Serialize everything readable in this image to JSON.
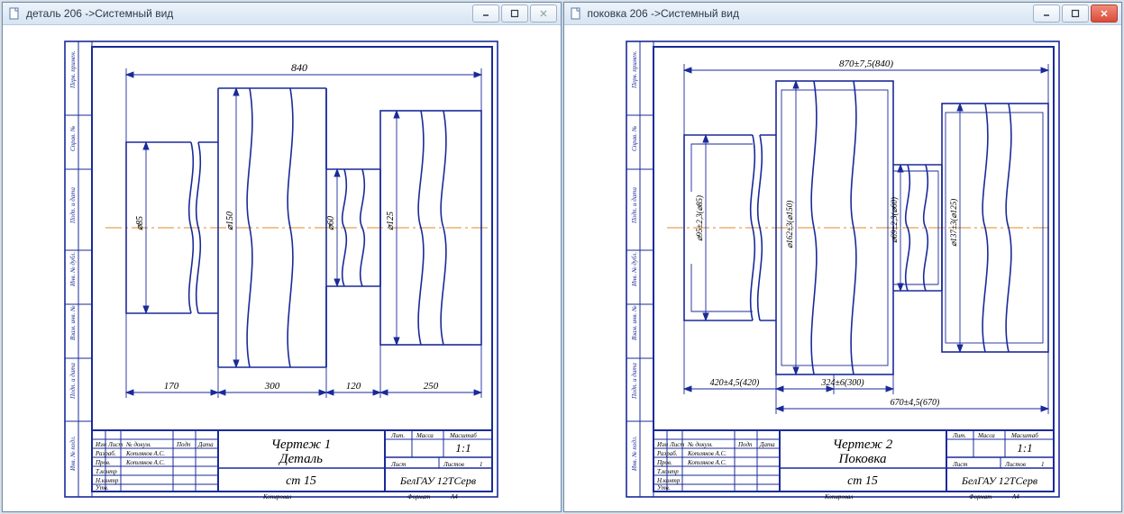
{
  "windows": [
    {
      "id": "left",
      "title": "деталь 206 ->Системный вид",
      "close_enabled": false,
      "drawing": {
        "title_line1": "Чертеж 1",
        "title_line2": "Деталь",
        "material": "ст 15",
        "org": "БелГАУ 12ТСерв",
        "scale": "1:1",
        "tb_labels": {
          "c1": "Изм",
          "c2": "Лист",
          "c3": "№ докум.",
          "c4": "Подп",
          "c5": "Дата",
          "r1": "Разраб.",
          "r2": "Пров.",
          "r3": "Т.контр",
          "r4": "Н.контр",
          "r5": "Утв.",
          "name1": "Котляков А.С.",
          "name2": "Котляков А.С.",
          "lit": "Лит.",
          "massa": "Масса",
          "mas": "Масштаб",
          "list": "Лист",
          "listov": "Листов",
          "one": "1",
          "kopiroval": "Копировал",
          "format": "Формат",
          "a4": "A4"
        },
        "side_labels": [
          "Перв. примен.",
          "Справ. №",
          "Подп. и дата",
          "Инв. № дубл.",
          "Взам. инв. №",
          "Подп. и дата",
          "Инв. № подл."
        ],
        "dims": {
          "top": "840",
          "bottoms": [
            "170",
            "300",
            "120",
            "250"
          ],
          "diams": [
            "⌀85",
            "⌀150",
            "⌀60",
            "⌀125"
          ]
        }
      }
    },
    {
      "id": "right",
      "title": "поковка 206 ->Системный вид",
      "close_enabled": true,
      "drawing": {
        "title_line1": "Чертеж 2",
        "title_line2": "Поковка",
        "material": "ст 15",
        "org": "БелГАУ 12ТСерв",
        "scale": "1:1",
        "tb_labels": {
          "c1": "Изм",
          "c2": "Лист",
          "c3": "№ докум.",
          "c4": "Подп",
          "c5": "Дата",
          "r1": "Разраб.",
          "r2": "Пров.",
          "r3": "Т.контр",
          "r4": "Н.контр",
          "r5": "Утв.",
          "name1": "Котляков А.С.",
          "name2": "Котляков А.С.",
          "lit": "Лит.",
          "massa": "Масса",
          "mas": "Масштаб",
          "list": "Лист",
          "listov": "Листов",
          "one": "1",
          "kopiroval": "Копировал",
          "format": "Формат",
          "a4": "A4"
        },
        "side_labels": [
          "Перв. примен.",
          "Справ. №",
          "Подп. и дата",
          "Инв. № дубл.",
          "Взам. инв. №",
          "Подп. и дата",
          "Инв. № подл."
        ],
        "dims": {
          "top": "870±7,5(840)",
          "bottoms": [
            "420±4,5(420)",
            "324±6(300)",
            "670±4,5(670)"
          ],
          "diams": [
            "⌀95±2,3(⌀85)",
            "⌀162±3(⌀150)",
            "⌀69±2,3(⌀60)",
            "⌀137±3(⌀125)"
          ]
        }
      }
    }
  ]
}
